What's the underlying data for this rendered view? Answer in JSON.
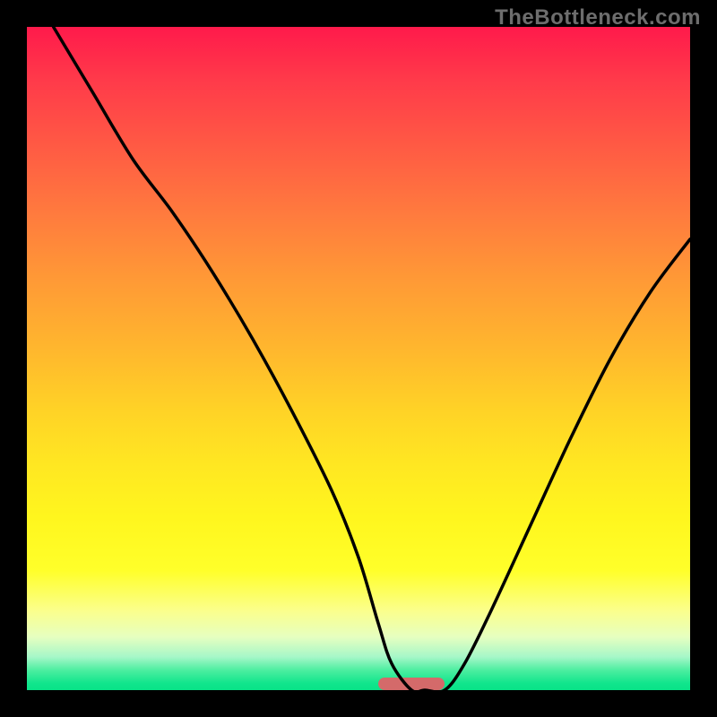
{
  "watermark": "TheBottleneck.com",
  "colors": {
    "frame_bg": "#000000",
    "curve_stroke": "#000000",
    "marker_fill": "#d46a6a",
    "watermark": "#6d6d6d"
  },
  "chart_data": {
    "type": "line",
    "title": "",
    "xlabel": "",
    "ylabel": "",
    "xlim": [
      0,
      100
    ],
    "ylim": [
      0,
      100
    ],
    "legend": false,
    "grid": false,
    "annotations": [
      "TheBottleneck.com"
    ],
    "background_gradient": {
      "direction": "vertical",
      "stops": [
        {
          "pos": 0.0,
          "color": "#ff1a4b"
        },
        {
          "pos": 0.5,
          "color": "#ffd326"
        },
        {
          "pos": 0.8,
          "color": "#ffff2a"
        },
        {
          "pos": 1.0,
          "color": "#09e388"
        }
      ]
    },
    "marker": {
      "x_start": 53,
      "x_end": 63,
      "y": 0
    },
    "series": [
      {
        "name": "bottleneck-curve",
        "x": [
          4,
          10,
          16,
          22,
          28,
          34,
          40,
          46,
          50,
          53,
          55,
          58,
          60,
          63,
          66,
          70,
          76,
          82,
          88,
          94,
          100
        ],
        "y": [
          100,
          90,
          80,
          72,
          63,
          53,
          42,
          30,
          20,
          10,
          4,
          0,
          0,
          0,
          4,
          12,
          25,
          38,
          50,
          60,
          68
        ]
      }
    ]
  }
}
